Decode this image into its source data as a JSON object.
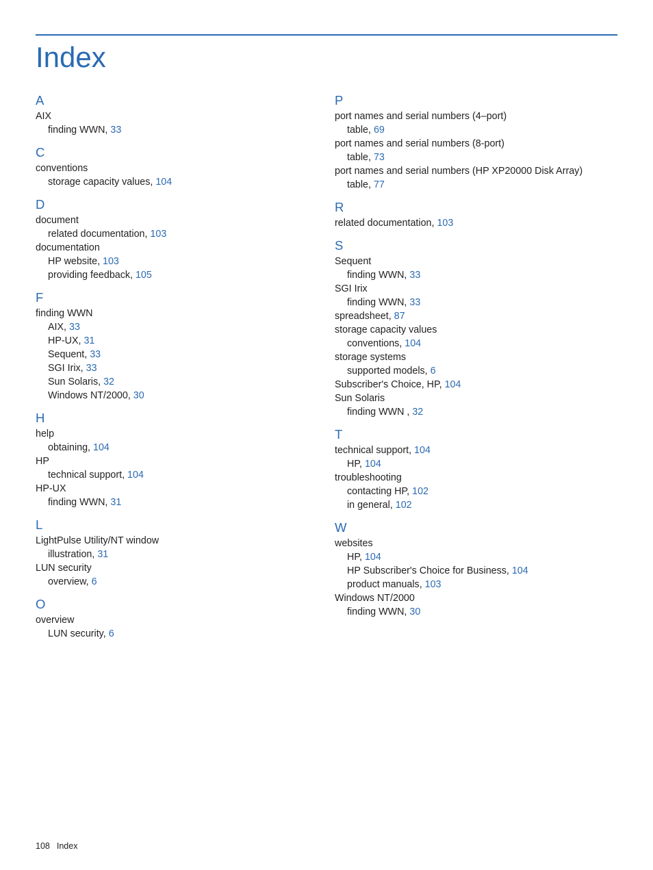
{
  "footer": {
    "page_number": "108",
    "section": "Index"
  },
  "title": "Index",
  "sections": [
    {
      "letter": "A",
      "entries": [
        {
          "level": 0,
          "text": "AIX"
        },
        {
          "level": 1,
          "text": "finding WWN",
          "page": "33",
          "comma": true
        }
      ]
    },
    {
      "letter": "C",
      "entries": [
        {
          "level": 0,
          "text": "conventions"
        },
        {
          "level": 1,
          "text": "storage capacity values",
          "page": "104",
          "comma": true
        }
      ]
    },
    {
      "letter": "D",
      "entries": [
        {
          "level": 0,
          "text": "document"
        },
        {
          "level": 1,
          "text": "related documentation",
          "page": "103",
          "comma": true
        },
        {
          "level": 0,
          "text": "documentation"
        },
        {
          "level": 1,
          "text": "HP website",
          "page": "103",
          "comma": true
        },
        {
          "level": 1,
          "text": "providing feedback",
          "page": "105",
          "comma": true
        }
      ]
    },
    {
      "letter": "F",
      "entries": [
        {
          "level": 0,
          "text": "finding WWN"
        },
        {
          "level": 1,
          "text": "AIX",
          "page": "33",
          "comma": true
        },
        {
          "level": 1,
          "text": "HP-UX",
          "page": "31",
          "comma": true
        },
        {
          "level": 1,
          "text": "Sequent",
          "page": "33",
          "comma": true
        },
        {
          "level": 1,
          "text": "SGI Irix",
          "page": "33",
          "comma": true
        },
        {
          "level": 1,
          "text": "Sun Solaris",
          "page": "32",
          "comma": true
        },
        {
          "level": 1,
          "text": "Windows NT/2000",
          "page": "30",
          "comma": true
        }
      ]
    },
    {
      "letter": "H",
      "entries": [
        {
          "level": 0,
          "text": "help"
        },
        {
          "level": 1,
          "text": "obtaining",
          "page": "104",
          "comma": true
        },
        {
          "level": 0,
          "text": "HP"
        },
        {
          "level": 1,
          "text": "technical support",
          "page": "104",
          "comma": true
        },
        {
          "level": 0,
          "text": "HP-UX"
        },
        {
          "level": 1,
          "text": "finding WWN",
          "page": "31",
          "comma": true
        }
      ]
    },
    {
      "letter": "L",
      "entries": [
        {
          "level": 0,
          "text": "LightPulse Utility/NT window"
        },
        {
          "level": 1,
          "text": "illustration",
          "page": "31",
          "comma": true
        },
        {
          "level": 0,
          "text": "LUN security"
        },
        {
          "level": 1,
          "text": "overview",
          "page": "6",
          "comma": true
        }
      ]
    },
    {
      "letter": "O",
      "entries": [
        {
          "level": 0,
          "text": "overview"
        },
        {
          "level": 1,
          "text": "LUN security",
          "page": "6",
          "comma": true
        }
      ]
    },
    {
      "letter": "P",
      "entries": [
        {
          "level": 0,
          "text": "port names and serial numbers (4–port)"
        },
        {
          "level": 1,
          "text": "table",
          "page": "69",
          "comma": true
        },
        {
          "level": 0,
          "text": "port names and serial numbers (8-port)"
        },
        {
          "level": 1,
          "text": "table",
          "page": "73",
          "comma": true
        },
        {
          "level": 0,
          "text": "port names and serial numbers (HP XP20000 Disk Array)"
        },
        {
          "level": 1,
          "text": "table",
          "page": "77",
          "comma": true
        }
      ]
    },
    {
      "letter": "R",
      "entries": [
        {
          "level": 0,
          "text": "related documentation",
          "page": "103",
          "comma": true
        }
      ]
    },
    {
      "letter": "S",
      "entries": [
        {
          "level": 0,
          "text": "Sequent"
        },
        {
          "level": 1,
          "text": "finding WWN",
          "page": "33",
          "comma": true
        },
        {
          "level": 0,
          "text": "SGI Irix"
        },
        {
          "level": 1,
          "text": "finding WWN",
          "page": "33",
          "comma": true
        },
        {
          "level": 0,
          "text": "spreadsheet",
          "page": "87",
          "comma": true
        },
        {
          "level": 0,
          "text": "storage capacity values"
        },
        {
          "level": 1,
          "text": "conventions",
          "page": "104",
          "comma": true
        },
        {
          "level": 0,
          "text": "storage systems"
        },
        {
          "level": 1,
          "text": "supported models",
          "page": "6",
          "comma": true
        },
        {
          "level": 0,
          "text": "Subscriber's Choice, HP",
          "page": "104",
          "comma": true
        },
        {
          "level": 0,
          "text": "Sun Solaris"
        },
        {
          "level": 1,
          "text": "finding WWN ",
          "page": "32",
          "comma": true
        }
      ]
    },
    {
      "letter": "T",
      "entries": [
        {
          "level": 0,
          "text": "technical support",
          "page": "104",
          "comma": true
        },
        {
          "level": 1,
          "text": "HP",
          "page": "104",
          "comma": true
        },
        {
          "level": 0,
          "text": "troubleshooting"
        },
        {
          "level": 1,
          "text": "contacting HP",
          "page": "102",
          "comma": true
        },
        {
          "level": 1,
          "text": "in general",
          "page": "102",
          "comma": true
        }
      ]
    },
    {
      "letter": "W",
      "entries": [
        {
          "level": 0,
          "text": "websites"
        },
        {
          "level": 1,
          "text": "HP",
          "page": "104",
          "comma": true
        },
        {
          "level": 1,
          "text": "HP Subscriber's Choice for Business",
          "page": "104",
          "comma": true
        },
        {
          "level": 1,
          "text": "product manuals",
          "page": "103",
          "comma": true
        },
        {
          "level": 0,
          "text": "Windows NT/2000"
        },
        {
          "level": 1,
          "text": "finding WWN",
          "page": "30",
          "comma": true
        }
      ]
    }
  ]
}
